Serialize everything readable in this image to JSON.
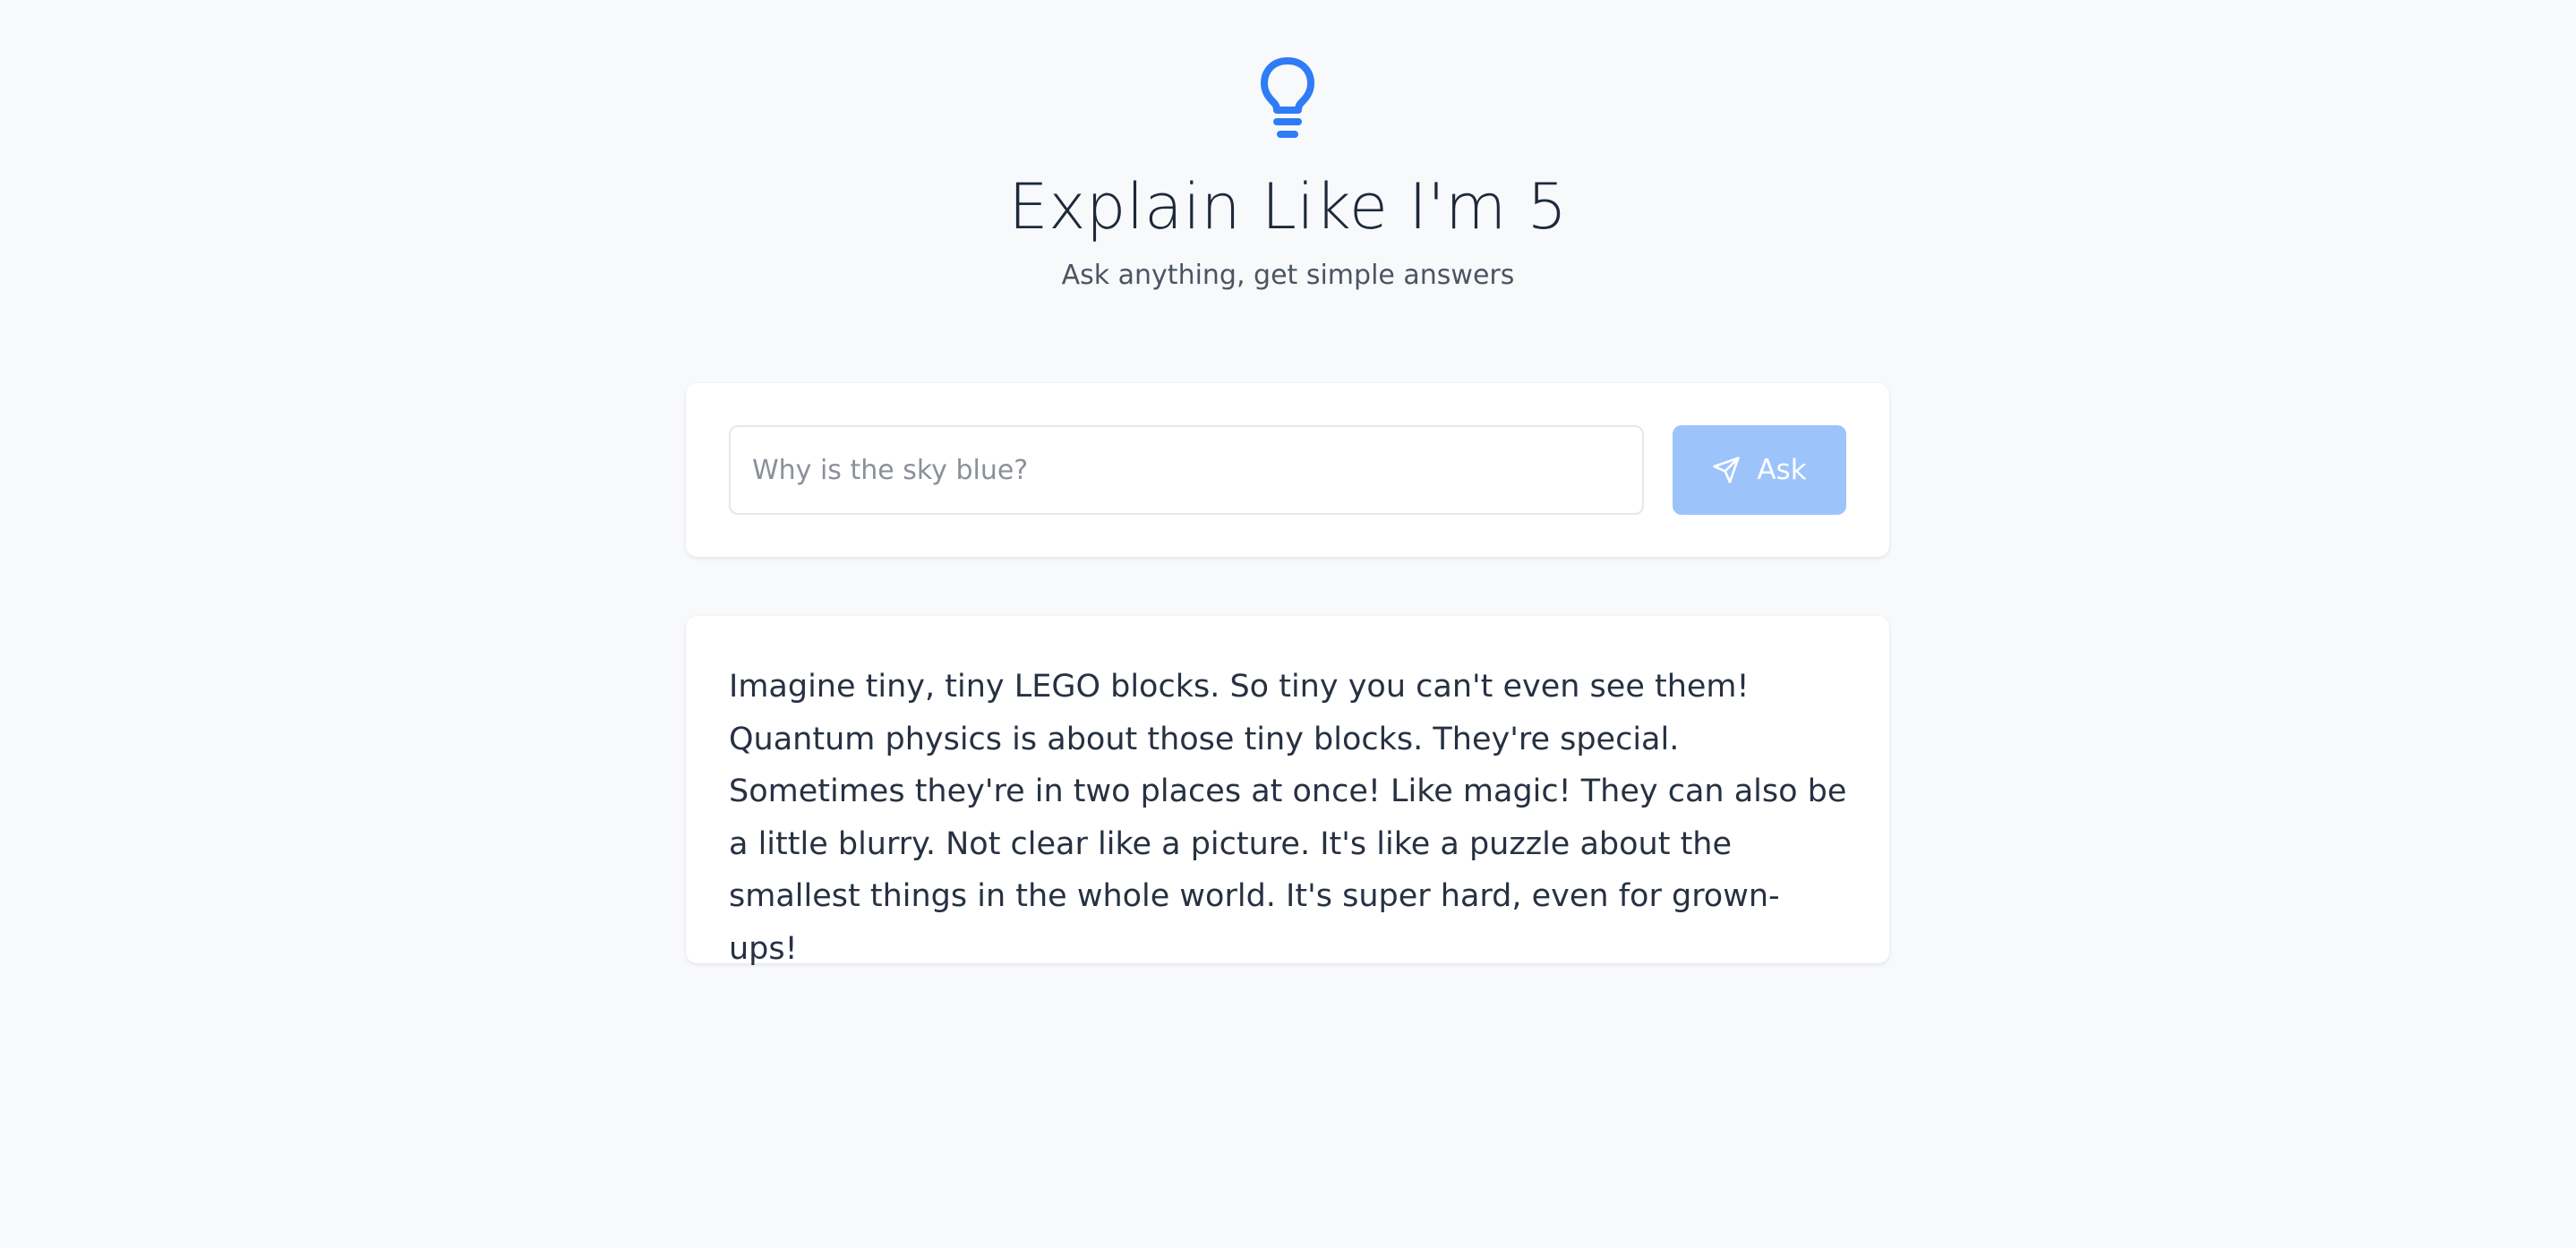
{
  "header": {
    "icon": "lightbulb-icon",
    "title": "Explain Like I'm 5",
    "subtitle": "Ask anything, get simple answers"
  },
  "ask_form": {
    "input_value": "",
    "placeholder": "Why is the sky blue?",
    "button_label": "Ask",
    "button_icon": "send-icon"
  },
  "answer": {
    "text": "Imagine tiny, tiny LEGO blocks. So tiny you can't even see them! Quantum physics is about those tiny blocks. They're special. Sometimes they're in two places at once! Like magic! They can also be a little blurry. Not clear like a picture. It's like a puzzle about the smallest things in the whole world. It's super hard, even for grown-ups!"
  },
  "colors": {
    "accent": "#2f7cf6",
    "button_disabled": "#9dc3fb",
    "background": "#f8f9fb",
    "card": "#ffffff"
  }
}
